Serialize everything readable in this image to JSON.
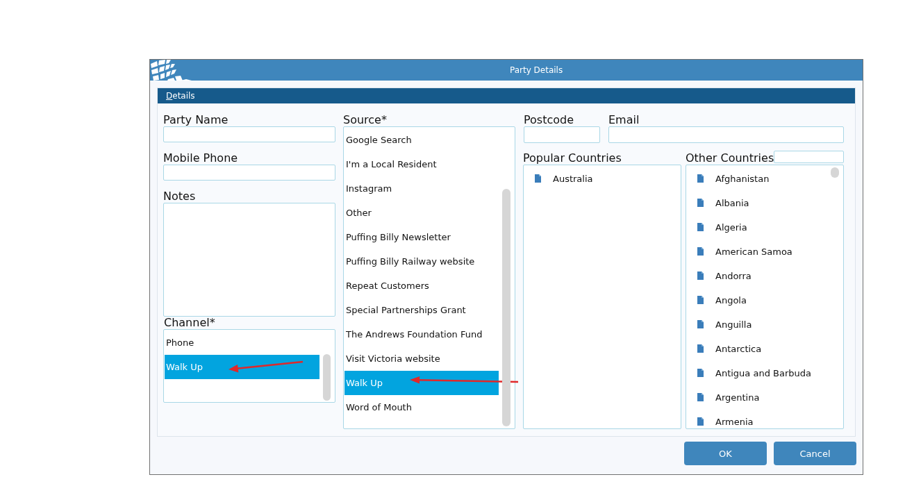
{
  "window": {
    "title": "Party Details"
  },
  "section": {
    "label": "Details",
    "underline_first_letter": true
  },
  "party_name": {
    "label": "Party Name"
  },
  "mobile_phone": {
    "label": "Mobile Phone"
  },
  "notes": {
    "label": "Notes"
  },
  "channel": {
    "label": "Channel*",
    "items": [
      {
        "label": "Phone",
        "selected": false,
        "marked_by_arrow": false
      },
      {
        "label": "Walk Up",
        "selected": true,
        "marked_by_arrow": true
      }
    ]
  },
  "source": {
    "label": "Source*",
    "items": [
      {
        "label": "Google Search",
        "selected": false,
        "marked_by_arrow": false
      },
      {
        "label": "I'm a Local Resident",
        "selected": false,
        "marked_by_arrow": false
      },
      {
        "label": "Instagram",
        "selected": false,
        "marked_by_arrow": false
      },
      {
        "label": "Other",
        "selected": false,
        "marked_by_arrow": false
      },
      {
        "label": "Puffing Billy Newsletter",
        "selected": false,
        "marked_by_arrow": false
      },
      {
        "label": "Puffing Billy Railway website",
        "selected": false,
        "marked_by_arrow": false
      },
      {
        "label": "Repeat Customers",
        "selected": false,
        "marked_by_arrow": false
      },
      {
        "label": "Special Partnerships Grant",
        "selected": false,
        "marked_by_arrow": false
      },
      {
        "label": "The Andrews Foundation Fund",
        "selected": false,
        "marked_by_arrow": false
      },
      {
        "label": "Visit Victoria website",
        "selected": false,
        "marked_by_arrow": false
      },
      {
        "label": "Walk Up",
        "selected": true,
        "marked_by_arrow": true
      },
      {
        "label": "Word of Mouth",
        "selected": false,
        "marked_by_arrow": false
      }
    ]
  },
  "postcode": {
    "label": "Postcode"
  },
  "email": {
    "label": "Email"
  },
  "popular_countries": {
    "label": "Popular Countries",
    "items": [
      {
        "label": "Australia",
        "selected": false
      }
    ]
  },
  "other_countries": {
    "label": "Other Countries",
    "items": [
      {
        "label": "Afghanistan",
        "selected": false
      },
      {
        "label": "Albania",
        "selected": false
      },
      {
        "label": "Algeria",
        "selected": false
      },
      {
        "label": "American Samoa",
        "selected": false
      },
      {
        "label": "Andorra",
        "selected": false
      },
      {
        "label": "Angola",
        "selected": false
      },
      {
        "label": "Anguilla",
        "selected": false
      },
      {
        "label": "Antarctica",
        "selected": false
      },
      {
        "label": "Antigua and Barbuda",
        "selected": false
      },
      {
        "label": "Argentina",
        "selected": false
      },
      {
        "label": "Armenia",
        "selected": false
      }
    ]
  },
  "buttons": [
    {
      "label": "OK"
    },
    {
      "label": "Cancel"
    }
  ]
}
